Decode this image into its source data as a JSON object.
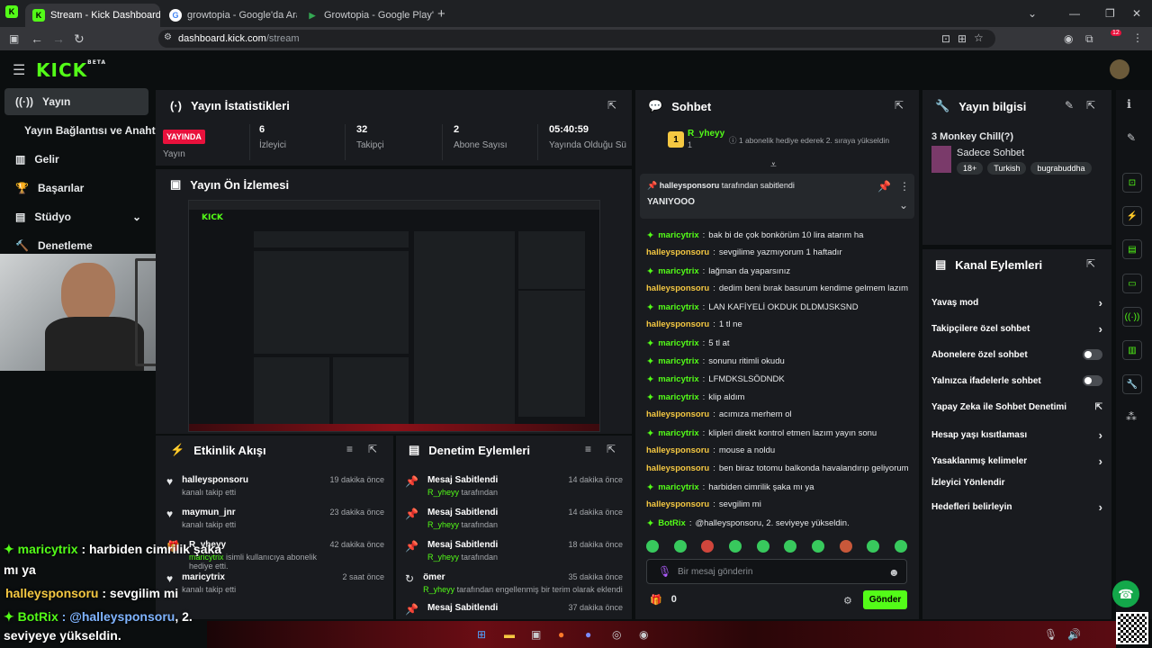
{
  "browser": {
    "tabs": [
      {
        "label": "Stream - Kick Dashboard",
        "active": true
      },
      {
        "label": "growtopia - Google'da Ara",
        "active": false
      },
      {
        "label": "Growtopia - Google Play'de Uyg",
        "active": false
      }
    ],
    "url_host": "dashboard.kick.com",
    "url_path": "/stream",
    "ext_badge": "12"
  },
  "brand": {
    "logo": "KICK",
    "beta": "BETA",
    "accent": "#53fc18"
  },
  "sidebar": {
    "items": [
      {
        "label": "Yayın",
        "icon": "broadcast-icon"
      },
      {
        "label": "Yayın Bağlantısı ve Anahtarı",
        "icon": ""
      },
      {
        "label": "Gelir",
        "icon": "chart-icon"
      },
      {
        "label": "Başarılar",
        "icon": "trophy-icon"
      },
      {
        "label": "Stüdyo",
        "icon": "studio-icon"
      },
      {
        "label": "Denetleme",
        "icon": "hammer-icon"
      }
    ]
  },
  "stats": {
    "title": "Yayın İstatistikleri",
    "live_label": "YAYINDA",
    "status_label": "Yayın",
    "items": [
      {
        "value": "6",
        "label": "İzleyici"
      },
      {
        "value": "32",
        "label": "Takipçi"
      },
      {
        "value": "2",
        "label": "Abone Sayısı"
      },
      {
        "value": "05:40:59",
        "label": "Yayında Olduğu Sü"
      }
    ]
  },
  "preview": {
    "title": "Yayın Ön İzlemesi"
  },
  "activity": {
    "title": "Etkinlik Akışı",
    "events": [
      {
        "user": "halleysponsoru",
        "text": "kanalı takip etti",
        "time": "19 dakika önce"
      },
      {
        "user": "maymun_jnr",
        "text": "kanalı takip etti",
        "time": "23 dakika önce"
      },
      {
        "user": "R_yheyy",
        "actor": "maricytrix",
        "text": "isimli kullanıcıya abonelik hediye etti.",
        "time": "42 dakika önce"
      },
      {
        "user": "maricytrix",
        "text": "kanalı takip etti",
        "time": "2 saat önce"
      }
    ]
  },
  "moderation": {
    "title": "Denetim Eylemleri",
    "actions": [
      {
        "title": "Mesaj Sabitlendi",
        "actor": "R_yheyy",
        "text": "tarafından",
        "time": "14 dakika önce"
      },
      {
        "title": "Mesaj Sabitlendi",
        "actor": "R_yheyy",
        "text": "tarafından",
        "time": "14 dakika önce"
      },
      {
        "title": "Mesaj Sabitlendi",
        "actor": "R_yheyy",
        "text": "tarafından",
        "time": "18 dakika önce"
      },
      {
        "title": "ömer",
        "actor": "R_yheyy",
        "text": "tarafından engellenmiş bir terim olarak eklendi",
        "time": "35 dakika önce"
      },
      {
        "title": "Mesaj Sabitlendi",
        "actor": "",
        "text": "",
        "time": "37 dakika önce"
      }
    ]
  },
  "chat": {
    "title": "Sohbet",
    "top_user": "R_yheyy",
    "top_rank": "1",
    "top_count": "1",
    "top_note": "1 abonelik hediye ederek 2. sıraya yükseldin",
    "pinned_by": "halleysponsoru",
    "pinned_suffix": "tarafından sabitlendi",
    "pinned_text": "YANIYOOO",
    "messages": [
      {
        "user": "maricytrix",
        "text": "bak bi de çok bonkörüm 10 lira atarım ha",
        "badge": true
      },
      {
        "user": "halleysponsoru",
        "text": "sevgilime yazmıyorum 1 haftadır",
        "badge": false
      },
      {
        "user": "maricytrix",
        "text": "lağman da yaparsınız",
        "badge": true
      },
      {
        "user": "halleysponsoru",
        "text": "dedim beni bırak basurum kendime gelmem lazım",
        "badge": false
      },
      {
        "user": "maricytrix",
        "text": "LAN KAFİYELİ OKDUK DLDMJSKSND",
        "badge": true
      },
      {
        "user": "halleysponsoru",
        "text": "1 tl ne",
        "badge": false
      },
      {
        "user": "maricytrix",
        "text": "5 tl at",
        "badge": true
      },
      {
        "user": "maricytrix",
        "text": "sonunu ritimli okudu",
        "badge": true
      },
      {
        "user": "maricytrix",
        "text": "LFMDKSLSÖDNDK",
        "badge": true
      },
      {
        "user": "maricytrix",
        "text": "klip aldım",
        "badge": true
      },
      {
        "user": "halleysponsoru",
        "text": "acımıza merhem ol",
        "badge": false
      },
      {
        "user": "maricytrix",
        "text": "klipleri direkt kontrol etmen lazım yayın sonu",
        "badge": true
      },
      {
        "user": "halleysponsoru",
        "text": "mouse a noldu",
        "badge": false
      },
      {
        "user": "halleysponsoru",
        "text": "ben biraz totomu balkonda havalandırıp geliyorum",
        "badge": false
      },
      {
        "user": "maricytrix",
        "text": "harbiden cimrilik şaka mı ya",
        "badge": true
      },
      {
        "user": "halleysponsoru",
        "text": "sevgilim mi",
        "badge": false
      },
      {
        "user": "BotRix",
        "text": "@halleysponsoru, 2. seviyeye yükseldin.",
        "badge": true
      }
    ],
    "input_placeholder": "Bir mesaj gönderin",
    "points": "0",
    "send_label": "Gönder"
  },
  "stream_info": {
    "title": "Yayın bilgisi",
    "stream_title": "3 Monkey Chill(?)",
    "category": "Sadece Sohbet",
    "tags": [
      "18+",
      "Turkish",
      "bugrabuddha"
    ]
  },
  "channel_actions": {
    "title": "Kanal Eylemleri",
    "items": [
      {
        "label": "Yavaş mod",
        "control": "arrow"
      },
      {
        "label": "Takipçilere özel sohbet",
        "control": "arrow"
      },
      {
        "label": "Abonelere özel sohbet",
        "control": "toggle"
      },
      {
        "label": "Yalnızca ifadelerle sohbet",
        "control": "toggle"
      },
      {
        "label": "Yapay Zeka ile Sohbet Denetimi",
        "control": "external"
      },
      {
        "label": "Hesap yaşı kısıtlaması",
        "control": "arrow"
      },
      {
        "label": "Yasaklanmış kelimeler",
        "control": "arrow"
      },
      {
        "label": "İzleyici Yönlendir",
        "control": "none"
      },
      {
        "label": "Hedefleri belirleyin",
        "control": "arrow"
      }
    ]
  },
  "overlay": {
    "line1_user": "maricytrix",
    "line1_text": ": harbiden cimrilik şaka",
    "line1_cont": "mı ya",
    "line2_user": "halleysponsoru",
    "line2_text": ": sevgilim mi",
    "line3_user": "BotRix",
    "line3_mention": ": @halleysponsoru",
    "line3_text": ", 2.",
    "line3_cont": "seviyeye yükseldin."
  }
}
